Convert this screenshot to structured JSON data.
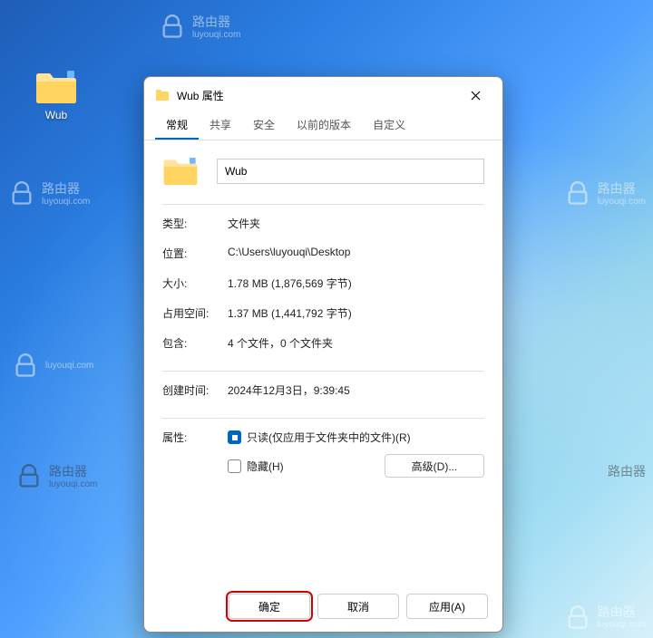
{
  "desktop": {
    "folder_label": "Wub"
  },
  "watermark": {
    "title": "路由器",
    "subtitle": "luyouqi.com"
  },
  "dialog": {
    "title": "Wub 属性",
    "tabs": {
      "general": "常规",
      "sharing": "共享",
      "security": "安全",
      "previous": "以前的版本",
      "customize": "自定义"
    },
    "name_value": "Wub",
    "rows": {
      "type_label": "类型:",
      "type_value": "文件夹",
      "location_label": "位置:",
      "location_value": "C:\\Users\\luyouqi\\Desktop",
      "size_label": "大小:",
      "size_value": "1.78 MB (1,876,569 字节)",
      "disk_label": "占用空间:",
      "disk_value": "1.37 MB (1,441,792 字节)",
      "contains_label": "包含:",
      "contains_value": "4 个文件，0 个文件夹",
      "created_label": "创建时间:",
      "created_value": "2024年12月3日，9:39:45",
      "attr_label": "属性:",
      "readonly_label": "只读(仅应用于文件夹中的文件)(R)",
      "hidden_label": "隐藏(H)",
      "advanced_label": "高级(D)..."
    },
    "buttons": {
      "ok": "确定",
      "cancel": "取消",
      "apply": "应用(A)"
    }
  }
}
